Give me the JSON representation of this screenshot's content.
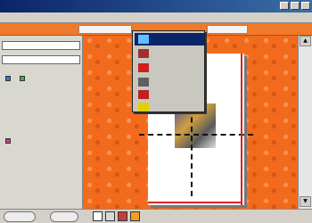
{
  "window": {
    "title": "",
    "status_text": ""
  },
  "colors": {
    "background": "#f26a1b",
    "menu_highlight": "#0a246a",
    "page_margin": "#d22222"
  },
  "popup_menu": {
    "items": [
      {
        "label": "",
        "icon": "image-frame-icon"
      },
      {
        "label": "",
        "icon": "rotate-icon"
      },
      {
        "label": "",
        "icon": "color-adjust-icon"
      },
      {
        "label": "",
        "icon": "line-tool-icon"
      },
      {
        "label": "",
        "icon": "crop-icon"
      },
      {
        "label": "",
        "icon": "layout-icon"
      }
    ]
  },
  "left_panel": {
    "header_1": "",
    "header_2": "",
    "rows": [
      "",
      "",
      "",
      "",
      "",
      "",
      "",
      ""
    ]
  },
  "bottom_toolbar": {
    "tools": [
      "pointer-icon",
      "grid-icon",
      "picture-icon",
      "swatch-icon"
    ]
  }
}
